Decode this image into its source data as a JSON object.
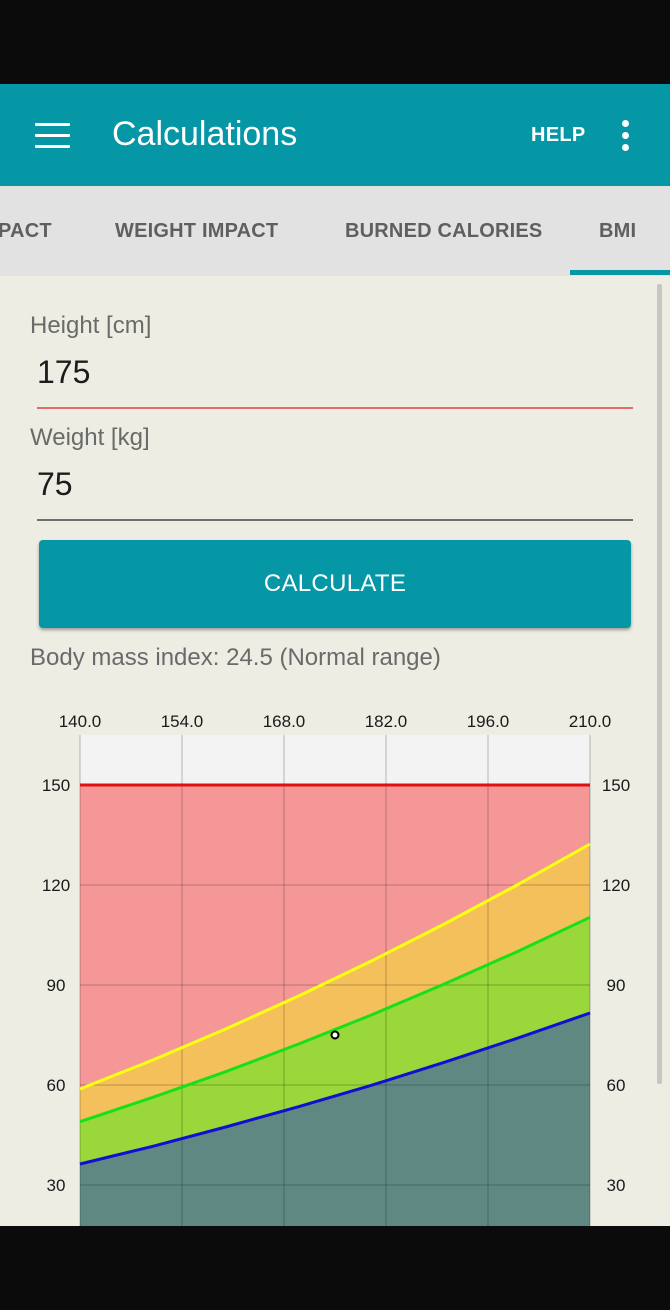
{
  "app_bar": {
    "title": "Calculations",
    "help_label": "HELP"
  },
  "tabs": [
    {
      "label": "PACT"
    },
    {
      "label": "WEIGHT IMPACT"
    },
    {
      "label": "BURNED CALORIES"
    },
    {
      "label": "BMI",
      "selected": true
    }
  ],
  "form": {
    "height_label": "Height [cm]",
    "height_value": "175",
    "weight_label": "Weight [kg]",
    "weight_value": "75",
    "calculate_label": "CALCULATE"
  },
  "result": {
    "text": "Body mass index: 24.5 (Normal range)"
  },
  "colors": {
    "primary": "#0597a5",
    "obese_zone": "#f59797",
    "overweight_zone": "#f4c05b",
    "normal_zone": "#9ad73a",
    "underweight_zone": "#5f8882",
    "red_line": "#e01010",
    "yellow_line": "#ffff10",
    "green_line": "#18e018",
    "blue_line": "#1010d0"
  },
  "chart_data": {
    "type": "line",
    "x_ticks": [
      "140.0",
      "154.0",
      "168.0",
      "182.0",
      "196.0",
      "210.0"
    ],
    "y_ticks": [
      "150",
      "120",
      "90",
      "60",
      "30"
    ],
    "xlim": [
      140,
      210
    ],
    "ylim": [
      15,
      165
    ],
    "grid": true,
    "series": [
      {
        "color": "#e01010",
        "x": [
          140,
          210
        ],
        "y": [
          150,
          150
        ]
      },
      {
        "color": "#ffff10",
        "x": [
          140,
          150,
          160,
          170,
          180,
          190,
          200,
          210
        ],
        "y": [
          58.8,
          67.5,
          76.8,
          86.7,
          97.2,
          108.3,
          120.0,
          132.3
        ]
      },
      {
        "color": "#18e018",
        "x": [
          140,
          150,
          160,
          170,
          180,
          190,
          200,
          210
        ],
        "y": [
          49.0,
          56.3,
          64.0,
          72.3,
          81.0,
          90.3,
          100.0,
          110.3
        ]
      },
      {
        "color": "#1010d0",
        "x": [
          140,
          150,
          160,
          170,
          180,
          190,
          200,
          210
        ],
        "y": [
          36.3,
          41.6,
          47.4,
          53.5,
          59.9,
          66.8,
          74.0,
          81.6
        ]
      }
    ],
    "point": {
      "x": 175,
      "y": 75
    }
  }
}
